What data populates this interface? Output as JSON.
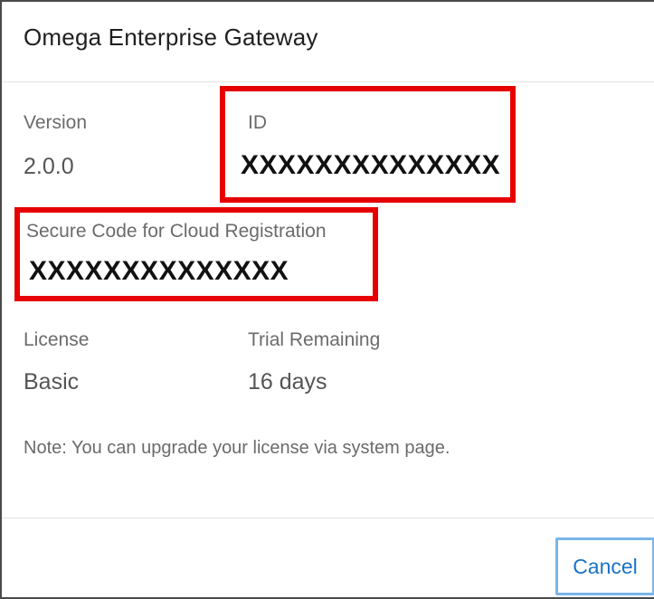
{
  "dialog": {
    "title": "Omega Enterprise Gateway",
    "version": {
      "label": "Version",
      "value": "2.0.0"
    },
    "id": {
      "label": "ID",
      "value": "XXXXXXXXXXXXXX"
    },
    "secure_code": {
      "label": "Secure Code for Cloud Registration",
      "value": "XXXXXXXXXXXXXX"
    },
    "license": {
      "label": "License",
      "value": "Basic"
    },
    "trial": {
      "label": "Trial Remaining",
      "value": "16 days"
    },
    "note": "Note: You can upgrade your license via system page.",
    "cancel_label": "Cancel"
  },
  "colors": {
    "highlight": "#e60000",
    "button_text": "#1a73c9",
    "button_border": "#7ab6ea"
  }
}
